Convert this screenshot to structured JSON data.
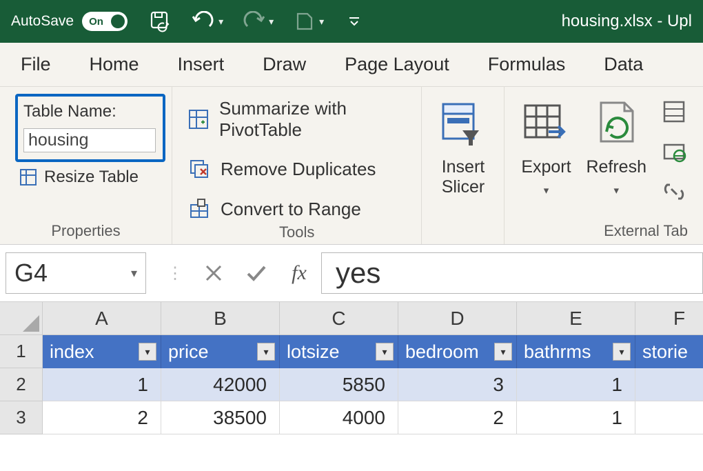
{
  "titlebar": {
    "autosave_label": "AutoSave",
    "toggle_text": "On",
    "document_title": "housing.xlsx - Upl"
  },
  "menu": {
    "tabs": [
      "File",
      "Home",
      "Insert",
      "Draw",
      "Page Layout",
      "Formulas",
      "Data"
    ]
  },
  "ribbon": {
    "properties": {
      "label": "Properties",
      "table_name_label": "Table Name:",
      "table_name_value": "housing",
      "resize_label": "Resize Table"
    },
    "tools": {
      "label": "Tools",
      "pivot": "Summarize with PivotTable",
      "remove_dup": "Remove Duplicates",
      "convert": "Convert to Range"
    },
    "slicer": {
      "label_line1": "Insert",
      "label_line2": "Slicer"
    },
    "export": {
      "label": "Export"
    },
    "refresh": {
      "label": "Refresh"
    },
    "external": {
      "label": "External Tab"
    }
  },
  "formula_bar": {
    "name_box": "G4",
    "formula": "yes"
  },
  "sheet": {
    "col_letters": [
      "A",
      "B",
      "C",
      "D",
      "E",
      "F"
    ],
    "row_numbers": [
      "1",
      "2",
      "3"
    ],
    "headers": [
      "index",
      "price",
      "lotsize",
      "bedroom",
      "bathrms",
      "storie"
    ],
    "rows": [
      [
        "1",
        "42000",
        "5850",
        "3",
        "1",
        ""
      ],
      [
        "2",
        "38500",
        "4000",
        "2",
        "1",
        ""
      ]
    ]
  }
}
